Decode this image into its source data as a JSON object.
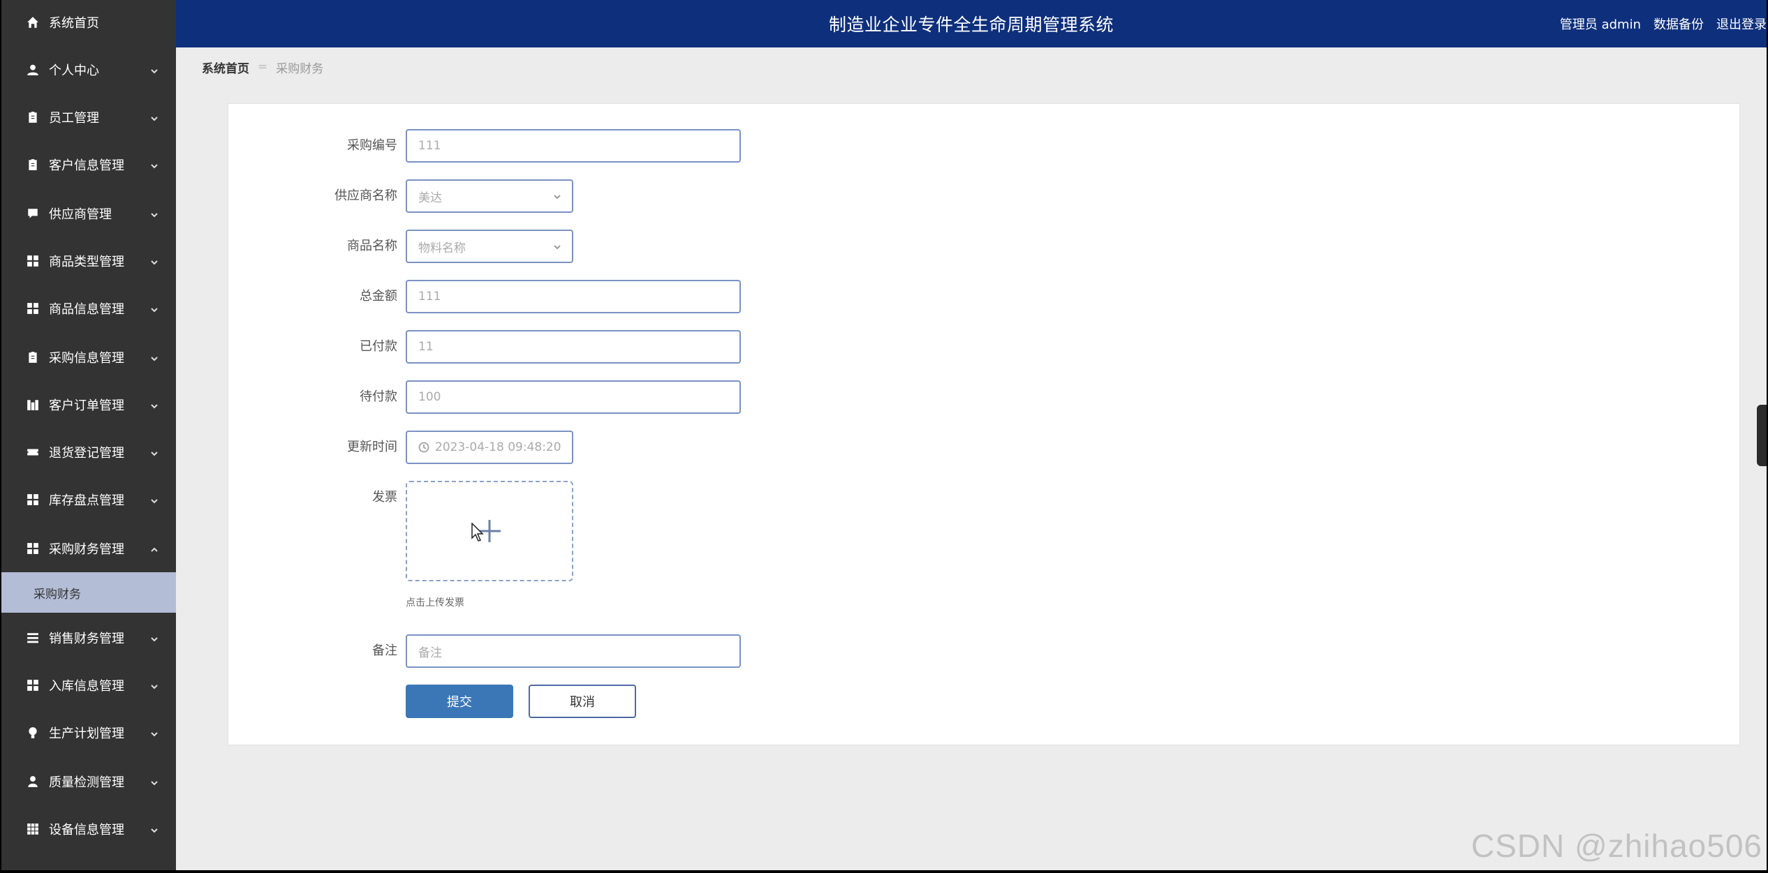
{
  "header": {
    "title": "制造业企业专件全生命周期管理系统",
    "role_user": "管理员 admin",
    "backup_link": "数据备份",
    "logout_link": "退出登录"
  },
  "sidebar": {
    "items": [
      {
        "label": "系统首页",
        "icon": "home-icon"
      },
      {
        "label": "个人中心",
        "icon": "user-icon"
      },
      {
        "label": "员工管理",
        "icon": "clipboard-icon"
      },
      {
        "label": "客户信息管理",
        "icon": "clipboard-icon"
      },
      {
        "label": "供应商管理",
        "icon": "chat-icon"
      },
      {
        "label": "商品类型管理",
        "icon": "grid-icon"
      },
      {
        "label": "商品信息管理",
        "icon": "grid-icon"
      },
      {
        "label": "采购信息管理",
        "icon": "clipboard-icon"
      },
      {
        "label": "客户订单管理",
        "icon": "chart-icon"
      },
      {
        "label": "退货登记管理",
        "icon": "ticket-icon"
      },
      {
        "label": "库存盘点管理",
        "icon": "grid-icon"
      },
      {
        "label": "采购财务管理",
        "icon": "grid-icon"
      },
      {
        "label": "销售财务管理",
        "icon": "list-icon"
      },
      {
        "label": "入库信息管理",
        "icon": "grid-icon"
      },
      {
        "label": "生产计划管理",
        "icon": "bulb-icon"
      },
      {
        "label": "质量检测管理",
        "icon": "person-icon"
      },
      {
        "label": "设备信息管理",
        "icon": "apps-icon"
      }
    ],
    "sub_item": "采购财务"
  },
  "breadcrumb": {
    "home": "系统首页",
    "separator": "=",
    "current": "采购财务"
  },
  "form": {
    "purchase_no": {
      "label": "采购编号",
      "value": "111"
    },
    "supplier": {
      "label": "供应商名称",
      "value": "美达"
    },
    "product": {
      "label": "商品名称",
      "placeholder": "物料名称"
    },
    "total": {
      "label": "总金额",
      "value": "111"
    },
    "paid": {
      "label": "已付款",
      "value": "11"
    },
    "pending": {
      "label": "待付款",
      "value": "100"
    },
    "updated": {
      "label": "更新时间",
      "value": "2023-04-18 09:48:20"
    },
    "invoice": {
      "label": "发票",
      "hint": "点击上传发票"
    },
    "remark": {
      "label": "备注",
      "placeholder": "备注"
    },
    "submit_label": "提交",
    "cancel_label": "取消"
  },
  "watermark": "CSDN @zhihao506"
}
